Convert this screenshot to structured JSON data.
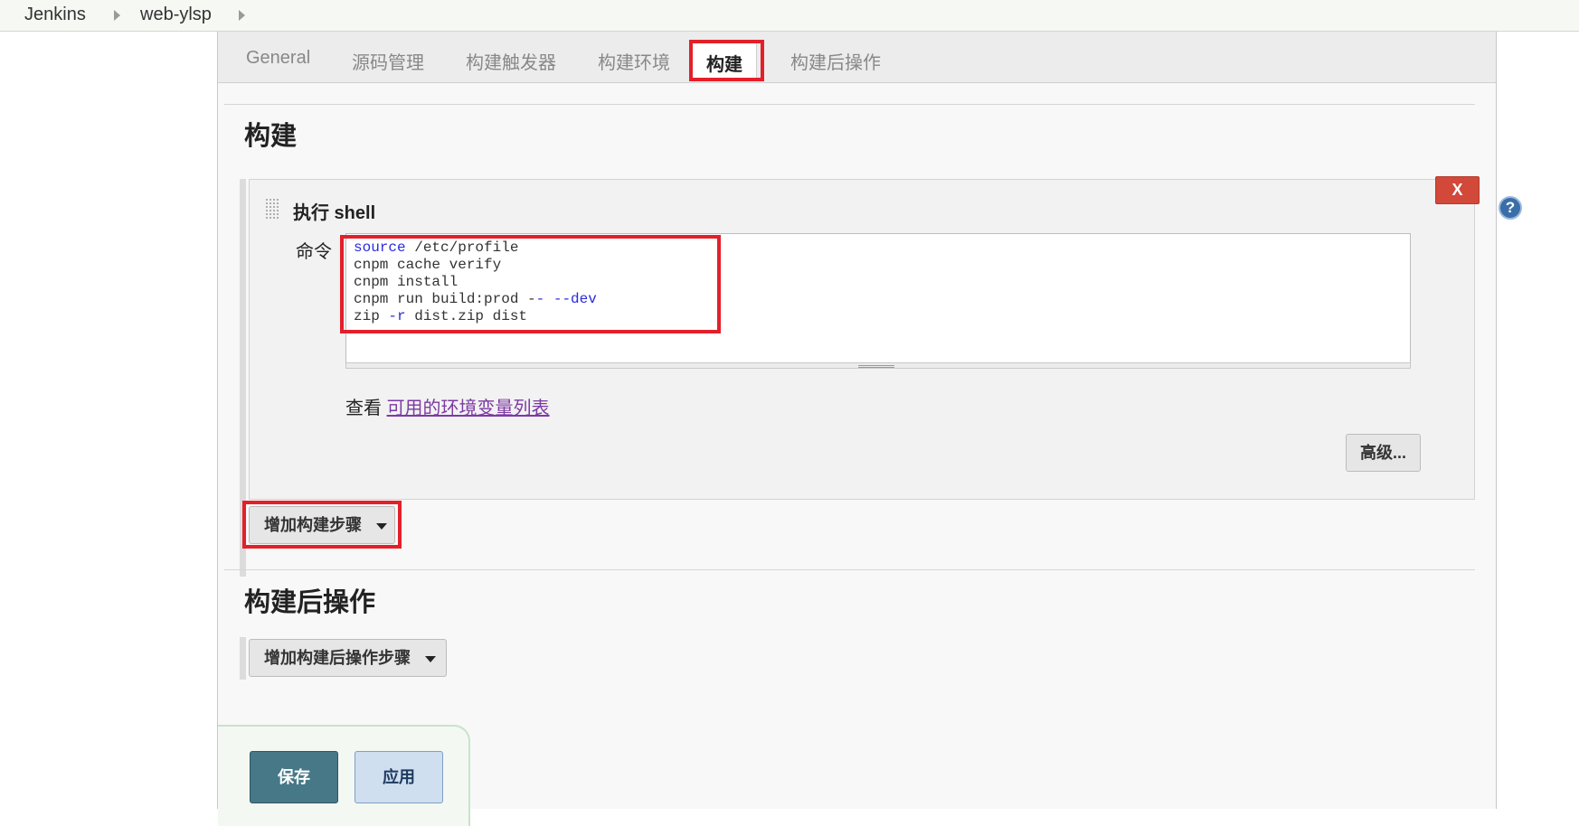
{
  "breadcrumb": {
    "items": [
      "Jenkins",
      "web-ylsp"
    ]
  },
  "tabs": [
    "General",
    "源码管理",
    "构建触发器",
    "构建环境",
    "构建",
    "构建后操作"
  ],
  "active_tab": "构建",
  "build_section": {
    "title": "构建",
    "step": {
      "title": "执行 shell",
      "delete_label": "X",
      "help_label": "?",
      "command_label": "命令",
      "command_lines": [
        "source /etc/profile",
        "cnpm cache verify",
        "cnpm install",
        "cnpm run build:prod -- --dev",
        "zip -r dist.zip dist"
      ],
      "env_prefix": "查看",
      "env_link": "可用的环境变量列表",
      "advanced_label": "高级..."
    },
    "add_step_label": "增加构建步骤"
  },
  "post_build_section": {
    "title": "构建后操作",
    "add_step_label": "增加构建后操作步骤"
  },
  "footer": {
    "save_label": "保存",
    "apply_label": "应用"
  },
  "colors": {
    "highlight": "#e3202a",
    "save": "#467888",
    "apply": "#cfdff0",
    "delete": "#d24839",
    "keyword": "#2a2ae0",
    "link": "#7c3aa2"
  }
}
